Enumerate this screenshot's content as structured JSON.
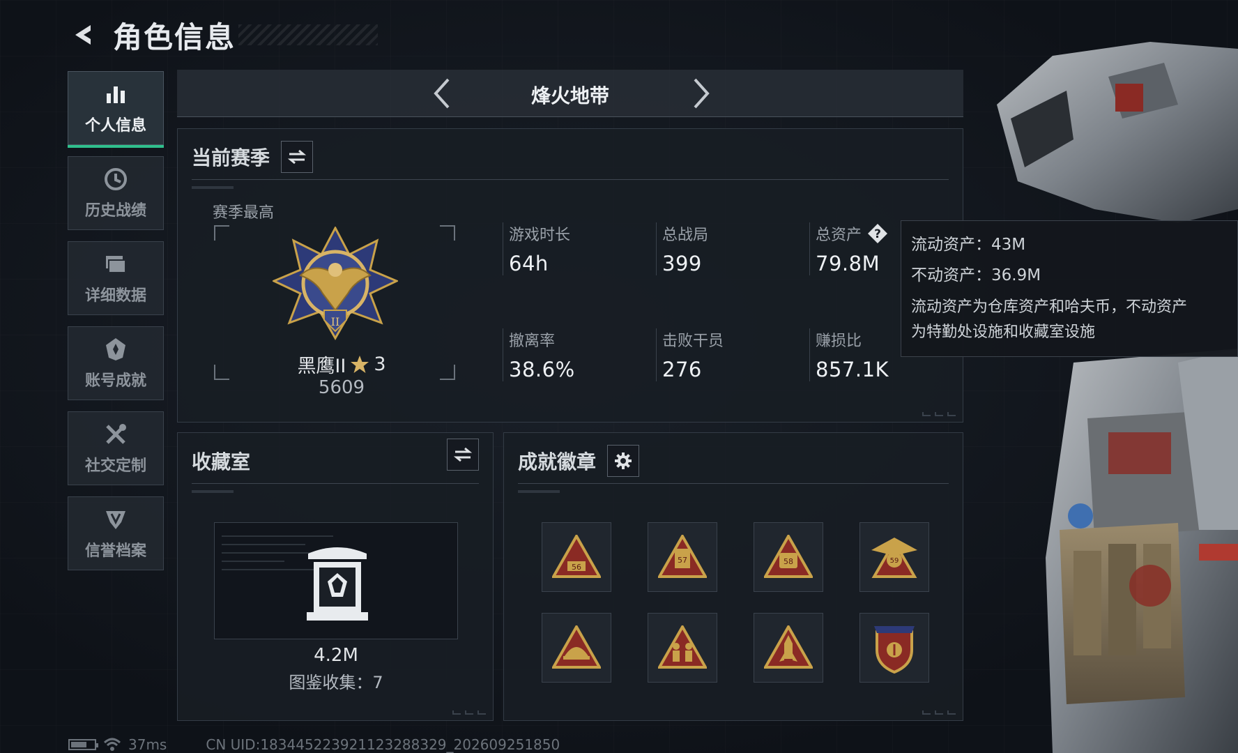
{
  "header": {
    "title": "角色信息"
  },
  "sidebar": {
    "items": [
      {
        "label": "个人信息",
        "icon": "bar-chart-icon",
        "active": true
      },
      {
        "label": "历史战绩",
        "icon": "clock-icon",
        "active": false
      },
      {
        "label": "详细数据",
        "icon": "folder-icon",
        "active": false
      },
      {
        "label": "账号成就",
        "icon": "achievement-icon",
        "active": false
      },
      {
        "label": "社交定制",
        "icon": "tools-icon",
        "active": false
      },
      {
        "label": "信誉档案",
        "icon": "shield-icon",
        "active": false
      }
    ]
  },
  "mode": {
    "title": "烽火地带"
  },
  "season": {
    "title": "当前赛季",
    "best_label": "赛季最高",
    "rank_name": "黑鹰II",
    "rank_stars": "3",
    "rank_score": "5609",
    "stats": [
      {
        "label": "游戏时长",
        "value": "64h"
      },
      {
        "label": "总战局",
        "value": "399"
      },
      {
        "label": "总资产",
        "value": "79.8M"
      },
      {
        "label": "撤离率",
        "value": "38.6%"
      },
      {
        "label": "击败干员",
        "value": "276"
      },
      {
        "label": "赚损比",
        "value": "857.1K"
      }
    ]
  },
  "tooltip": {
    "liquid": "流动资产：43M",
    "fixed": "不动资产：36.9M",
    "note_line1": "流动资产为仓库资产和哈夫币，不动资产",
    "note_line2": "为特勤处设施和收藏室设施"
  },
  "collection": {
    "title": "收藏室",
    "value": "4.2M",
    "count_text": "图鉴收集：7"
  },
  "achievements": {
    "title": "成就徽章",
    "badges": [
      {
        "label": "56",
        "icon": "badge-56-icon"
      },
      {
        "label": "57",
        "icon": "badge-57-icon"
      },
      {
        "label": "58",
        "icon": "badge-58-icon"
      },
      {
        "label": "59",
        "icon": "badge-59-icon"
      },
      {
        "label": "",
        "icon": "badge-helmet-icon"
      },
      {
        "label": "",
        "icon": "badge-soldiers-icon"
      },
      {
        "label": "",
        "icon": "badge-rocket-icon"
      },
      {
        "label": "",
        "icon": "badge-shield-icon"
      }
    ]
  },
  "footer": {
    "ping": "37ms",
    "uid": "CN UID:1834452239211232883​29_202609251850"
  },
  "colors": {
    "accent": "#2fc08d",
    "gold": "#c9a24a",
    "badge_red": "#8a2a24"
  }
}
